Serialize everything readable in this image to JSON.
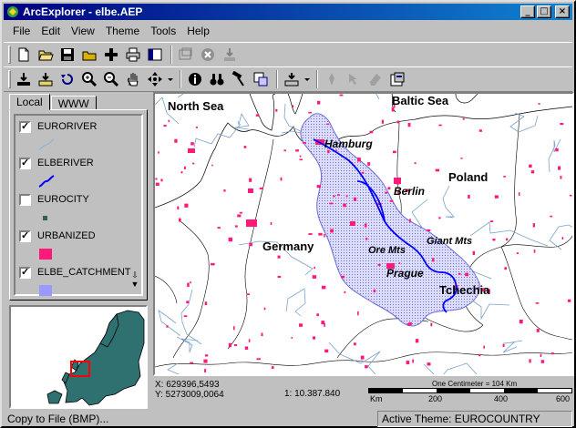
{
  "window": {
    "title": "ArcExplorer - elbe.AEP"
  },
  "menu": [
    "File",
    "Edit",
    "View",
    "Theme",
    "Tools",
    "Help"
  ],
  "tabs": {
    "local": "Local",
    "www": "WWW"
  },
  "layers": [
    {
      "name": "EURORIVER",
      "checked": true,
      "symbol": "river-line",
      "color": "#8ab0d8"
    },
    {
      "name": "ELBERIVER",
      "checked": true,
      "symbol": "river-line",
      "color": "#0000ff"
    },
    {
      "name": "EUROCITY",
      "checked": false,
      "symbol": "point",
      "color": "#2f5f5f"
    },
    {
      "name": "URBANIZED",
      "checked": true,
      "symbol": "fill",
      "color": "#ff1a7a"
    },
    {
      "name": "ELBE_CATCHMENT",
      "checked": true,
      "symbol": "fill",
      "color": "#9999ff"
    }
  ],
  "map": {
    "labels": {
      "north_sea": "North Sea",
      "baltic_sea": "Baltic Sea",
      "poland": "Poland",
      "germany": "Germany",
      "tchechia": "Tchechia",
      "hamburg": "Hamburg",
      "berlin": "Berlin",
      "prague": "Prague",
      "ore_mts": "Ore Mts",
      "giant_mts": "Giant Mts"
    }
  },
  "coords": {
    "x": "X: 629396,5493",
    "y": "Y: 5273009,0064"
  },
  "scale": {
    "ratio": "1: 10.387.840",
    "caption": "One Centimeter = 104 Km",
    "unit": "Km",
    "ticks": [
      "200",
      "400",
      "600"
    ]
  },
  "status": {
    "left": "Copy to File (BMP)...",
    "right": "Active Theme: EUROCOUNTRY"
  },
  "colors": {
    "title_start": "#000080",
    "title_end": "#1084d0",
    "urban": "#ff1a7a",
    "catchment": "#9999ff",
    "river": "#0000ff",
    "country": "#2f7070"
  }
}
